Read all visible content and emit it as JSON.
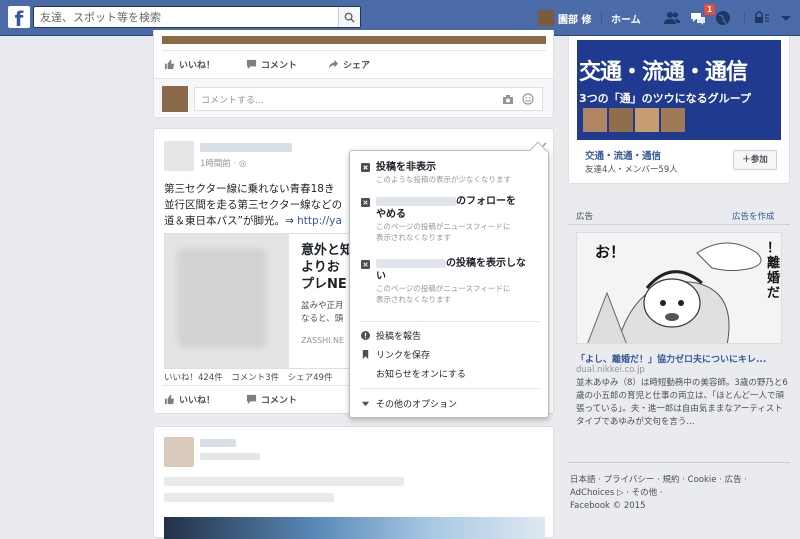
{
  "topbar": {
    "logo_text": "f",
    "search_placeholder": "友達、スポット等を検索",
    "user_name": "園部 修",
    "home_label": "ホーム",
    "notification_count": "1"
  },
  "post1": {
    "like_label": "いいね！",
    "comment_label": "コメント",
    "share_label": "シェア",
    "comment_placeholder": "コメントする..."
  },
  "post2": {
    "timestamp": "1時間前 · ",
    "body_line1": "第三セクター線に乗れない青春18き",
    "body_line2": "並行区間を走る第三セクター線などの",
    "body_line3_pre": "道＆東日本パス”が脚光。⇒ ",
    "body_link": "http://ya",
    "link_title_1": "意外と知",
    "link_title_2": "よりお",
    "link_title_3": "プレNE",
    "link_desc_1": "盆みや正月",
    "link_desc_2": "なると、頭",
    "link_domain": "ZASSHI.NE",
    "stats": "いいね！424件　コメント3件　シェア49件",
    "like_label": "いいね！",
    "comment_label": "コメント"
  },
  "menu": {
    "hide_post": "投稿を非表示",
    "hide_post_sub": "このような投稿の表示が少なくなります",
    "unfollow_suffix": "のフォローを",
    "unfollow_line2": "やめる",
    "unfollow_sub1": "このページの投稿がニュースフィードに",
    "unfollow_sub2": "表示されなくなります",
    "hide_all_suffix": "の投稿を表示しな",
    "hide_all_line2": "い",
    "hide_all_sub1": "このページの投稿がニュースフィードに",
    "hide_all_sub2": "表示されなくなります",
    "report": "投稿を報告",
    "save_link": "リンクを保存",
    "notifications_on": "お知らせをオンにする",
    "more_options": "その他のオプション"
  },
  "sidebar": {
    "group_banner_text": "交通・流通・通信",
    "group_banner_sub": "3つの「通」のツウになるグループ",
    "group_name": "交通・流通・通信",
    "group_meta": "友達4人・メンバー59人",
    "join_label": "＋参加",
    "ad_label": "広告",
    "create_ad_label": "広告を作成",
    "manga_text_1": "お！",
    "manga_text_2": "！離婚だ！！",
    "ad_headline": "「よし、離婚だ！」協力ゼロ夫についにキレ...",
    "ad_domain": "dual.nikkei.co.jp",
    "ad_body": "並木あゆみ（8）は時短勤務中の美容師。3歳の野乃と6歳の小五郎の育児と仕事の両立は、「ほとんど一人で頑張っている」。夫・進一郎は自由気ままなアーティストタイプであゆみが文句を言う...",
    "footer_line1": "日本語 · プライバシー · 規約 · Cookie · 広告 ·",
    "footer_line2": "AdChoices ▷ · その他 ·",
    "footer_line3": "Facebook © 2015"
  },
  "colors": {
    "topbar": "#4a6aa8",
    "link": "#365899",
    "badge": "#e74c3c"
  }
}
